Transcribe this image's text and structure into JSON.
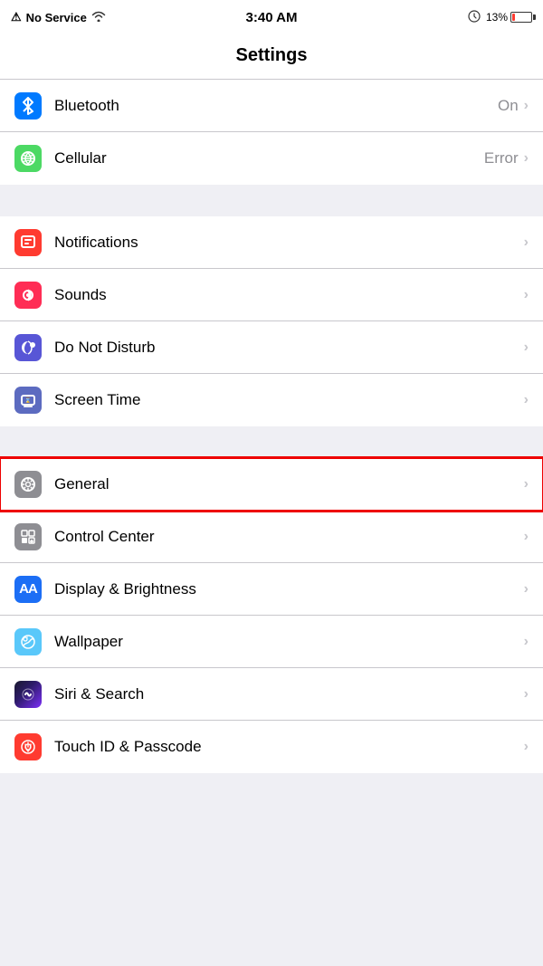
{
  "statusBar": {
    "left": "No Service",
    "time": "3:40 AM",
    "batteryPercent": "13%",
    "noServiceIcon": "⚠",
    "wifiIcon": "wifi"
  },
  "pageTitle": "Settings",
  "sections": [
    {
      "id": "connectivity",
      "rows": [
        {
          "id": "bluetooth",
          "label": "Bluetooth",
          "value": "On",
          "iconBg": "icon-blue",
          "iconSymbol": "bluetooth"
        },
        {
          "id": "cellular",
          "label": "Cellular",
          "value": "Error",
          "iconBg": "icon-green",
          "iconSymbol": "cellular"
        }
      ]
    },
    {
      "id": "notifications",
      "rows": [
        {
          "id": "notifications",
          "label": "Notifications",
          "value": "",
          "iconBg": "icon-red",
          "iconSymbol": "notifications"
        },
        {
          "id": "sounds",
          "label": "Sounds",
          "value": "",
          "iconBg": "icon-pink",
          "iconSymbol": "sounds"
        },
        {
          "id": "donotdisturb",
          "label": "Do Not Disturb",
          "value": "",
          "iconBg": "icon-purple",
          "iconSymbol": "dnd"
        },
        {
          "id": "screentime",
          "label": "Screen Time",
          "value": "",
          "iconBg": "icon-indigo",
          "iconSymbol": "screentime"
        }
      ]
    },
    {
      "id": "general",
      "rows": [
        {
          "id": "general",
          "label": "General",
          "value": "",
          "iconBg": "icon-gray",
          "iconSymbol": "general",
          "highlighted": true
        },
        {
          "id": "controlcenter",
          "label": "Control Center",
          "value": "",
          "iconBg": "icon-gray",
          "iconSymbol": "controlcenter"
        },
        {
          "id": "display",
          "label": "Display & Brightness",
          "value": "",
          "iconBg": "icon-dark-blue",
          "iconSymbol": "display"
        },
        {
          "id": "wallpaper",
          "label": "Wallpaper",
          "value": "",
          "iconBg": "icon-teal",
          "iconSymbol": "wallpaper"
        },
        {
          "id": "siri",
          "label": "Siri & Search",
          "value": "",
          "iconBg": "icon-siri",
          "iconSymbol": "siri"
        },
        {
          "id": "touchid",
          "label": "Touch ID & Passcode",
          "value": "",
          "iconBg": "icon-touch",
          "iconSymbol": "touchid"
        }
      ]
    }
  ]
}
